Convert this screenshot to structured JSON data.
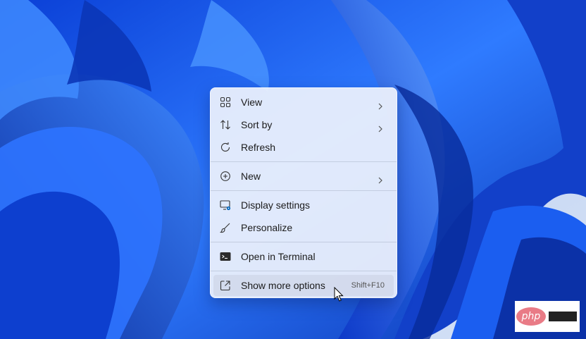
{
  "context_menu": {
    "items": [
      {
        "label": "View",
        "icon": "grid-icon",
        "has_submenu": true
      },
      {
        "label": "Sort by",
        "icon": "sort-icon",
        "has_submenu": true
      },
      {
        "label": "Refresh",
        "icon": "refresh-icon",
        "has_submenu": false
      },
      {
        "label": "New",
        "icon": "plus-circle-icon",
        "has_submenu": true
      },
      {
        "label": "Display settings",
        "icon": "display-icon",
        "has_submenu": false
      },
      {
        "label": "Personalize",
        "icon": "brush-icon",
        "has_submenu": false
      },
      {
        "label": "Open in Terminal",
        "icon": "terminal-icon",
        "has_submenu": false
      },
      {
        "label": "Show more options",
        "icon": "share-icon",
        "shortcut": "Shift+F10",
        "hovered": true
      }
    ]
  },
  "watermark": {
    "text": "php"
  },
  "colors": {
    "wallpaper_blue": "#1a5be8",
    "menu_background": "#eef2fc",
    "hover": "#c8d0e1",
    "accent": "#0067c0"
  }
}
